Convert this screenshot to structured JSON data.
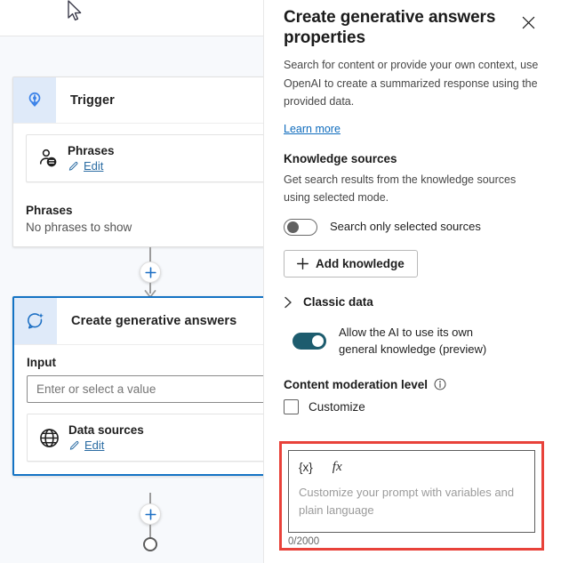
{
  "canvas": {
    "trigger_node": {
      "icon": "trigger-lightbulb-icon",
      "title": "Trigger",
      "phrases_card": {
        "icon": "person-chat-icon",
        "title": "Phrases",
        "edit_label": "Edit",
        "edit_icon": "pencil-icon"
      },
      "phrases_section": {
        "title": "Phrases",
        "empty_text": "No phrases to show"
      }
    },
    "generative_node": {
      "icon": "generative-answers-sparkle-icon",
      "title": "Create generative answers",
      "input_label": "Input",
      "input_placeholder": "Enter or select a value",
      "input_value": "",
      "data_sources_card": {
        "icon": "globe-icon",
        "title": "Data sources",
        "edit_label": "Edit",
        "edit_icon": "pencil-icon"
      }
    },
    "add_node_icon": "plus-icon",
    "end_node_icon": "end-circle-icon",
    "cursor_icon": "mouse-pointer-icon"
  },
  "panel": {
    "title": "Create generative answers properties",
    "close_icon": "close-icon",
    "description": "Search for content or provide your own context, use OpenAI to create a summarized response using the provided data.",
    "learn_more": "Learn more",
    "knowledge_sources": {
      "title": "Knowledge sources",
      "description": "Get search results from the knowledge sources using selected mode.",
      "toggle_label": "Search only selected sources",
      "toggle_state": "off",
      "add_button_label": "Add knowledge",
      "add_button_icon": "plus-icon"
    },
    "classic_data": {
      "label": "Classic data",
      "chevron_icon": "chevron-right-icon",
      "expanded": false,
      "ai_toggle_label": "Allow the AI to use its own general knowledge (preview)",
      "ai_toggle_state": "on"
    },
    "content_moderation": {
      "title": "Content moderation level",
      "info_icon": "info-icon",
      "customize_label": "Customize",
      "customize_checked": false,
      "prompt": {
        "var_button": "{x}",
        "fx_button": "fx",
        "placeholder": "Customize your prompt with variables and plain language",
        "value": "",
        "char_counter": "0/2000"
      }
    }
  },
  "colors": {
    "accent_blue": "#0f6cbd",
    "node_border_selected": "#1473c4",
    "toggle_on": "#1d5c6e",
    "highlight_red": "#e8423a",
    "canvas_bg": "#f7f9fc"
  }
}
